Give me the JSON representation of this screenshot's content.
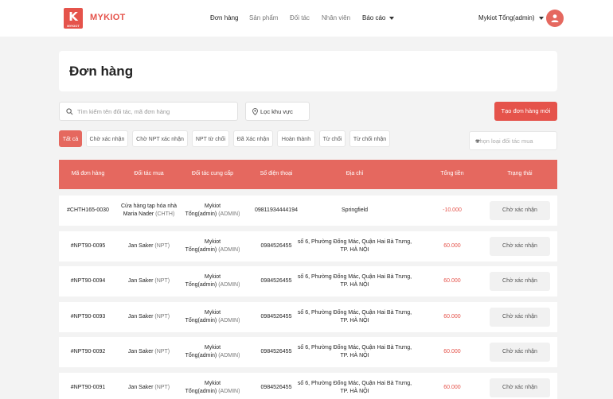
{
  "brand": {
    "logo_letter": "K",
    "logo_small": "MYKIOT",
    "name": "MYKIOT",
    "color": "#e5534b"
  },
  "nav": [
    {
      "label": "Đơn hàng",
      "active": true
    },
    {
      "label": "Sản phẩm",
      "active": false
    },
    {
      "label": "Đối tác",
      "active": false
    },
    {
      "label": "Nhân viên",
      "active": false
    },
    {
      "label": "Báo cáo",
      "active": false,
      "dropdown": true
    }
  ],
  "user": {
    "name": "Mykiot Tổng(admin)",
    "avatar_icon": "user-icon"
  },
  "page": {
    "title": "Đơn hàng"
  },
  "filters": {
    "search_placeholder": "Tìm kiếm tên đối tác, mã đơn hàng",
    "region_label": "Lọc khu vực",
    "create_button": "Tạo đơn hàng mới",
    "partner_type_placeholder": "Chọn loại đối tác mua"
  },
  "tabs": [
    {
      "label": "Tất cả",
      "active": true
    },
    {
      "label": "Chờ xác nhận",
      "active": false
    },
    {
      "label": "Chờ NPT xác nhận",
      "active": false
    },
    {
      "label": "NPT từ chối",
      "active": false
    },
    {
      "label": "Đã Xác nhận",
      "active": false
    },
    {
      "label": "Hoàn thành",
      "active": false
    },
    {
      "label": "Từ chối",
      "active": false
    },
    {
      "label": "Từ chối nhận",
      "active": false
    }
  ],
  "table": {
    "header_color": "#e5685f",
    "columns": [
      "Mã đơn hàng",
      "Đối tác mua",
      "Đối tác cung cấp",
      "Số điện thoại",
      "Địa chỉ",
      "Tổng tiền",
      "Trạng thái"
    ],
    "rows": [
      {
        "code": "#CHTH165-0030",
        "buyer_line1": "Cửa hàng tạp hóa nhà",
        "buyer_line2": "Maria Nader",
        "buyer_tag": "(CHTH)",
        "supplier_line1": "Mykiot",
        "supplier_line2": "Tổng(admin)",
        "supplier_tag": "(ADMIN)",
        "phone": "09811934444194",
        "address_line1": "Springfield",
        "address_line2": "",
        "total": "-10.000",
        "status": "Chờ xác nhận"
      },
      {
        "code": "#NPT90-0095",
        "buyer_line1": "Jan Saker",
        "buyer_line2": "",
        "buyer_tag": "(NPT)",
        "supplier_line1": "Mykiot",
        "supplier_line2": "Tổng(admin)",
        "supplier_tag": "(ADMIN)",
        "phone": "0984526455",
        "address_line1": "số 6, Phường Đống Mác, Quận Hai Bà Trưng,",
        "address_line2": "TP. HÀ NỘI",
        "total": "60.000",
        "status": "Chờ xác nhận"
      },
      {
        "code": "#NPT90-0094",
        "buyer_line1": "Jan Saker",
        "buyer_line2": "",
        "buyer_tag": "(NPT)",
        "supplier_line1": "Mykiot",
        "supplier_line2": "Tổng(admin)",
        "supplier_tag": "(ADMIN)",
        "phone": "0984526455",
        "address_line1": "số 6, Phường Đống Mác, Quận Hai Bà Trưng,",
        "address_line2": "TP. HÀ NỘI",
        "total": "60.000",
        "status": "Chờ xác nhận"
      },
      {
        "code": "#NPT90-0093",
        "buyer_line1": "Jan Saker",
        "buyer_line2": "",
        "buyer_tag": "(NPT)",
        "supplier_line1": "Mykiot",
        "supplier_line2": "Tổng(admin)",
        "supplier_tag": "(ADMIN)",
        "phone": "0984526455",
        "address_line1": "số 6, Phường Đống Mác, Quận Hai Bà Trưng,",
        "address_line2": "TP. HÀ NỘI",
        "total": "60.000",
        "status": "Chờ xác nhận"
      },
      {
        "code": "#NPT90-0092",
        "buyer_line1": "Jan Saker",
        "buyer_line2": "",
        "buyer_tag": "(NPT)",
        "supplier_line1": "Mykiot",
        "supplier_line2": "Tổng(admin)",
        "supplier_tag": "(ADMIN)",
        "phone": "0984526455",
        "address_line1": "số 6, Phường Đống Mác, Quận Hai Bà Trưng,",
        "address_line2": "TP. HÀ NỘI",
        "total": "60.000",
        "status": "Chờ xác nhận"
      },
      {
        "code": "#NPT90-0091",
        "buyer_line1": "Jan Saker",
        "buyer_line2": "",
        "buyer_tag": "(NPT)",
        "supplier_line1": "Mykiot",
        "supplier_line2": "Tổng(admin)",
        "supplier_tag": "(ADMIN)",
        "phone": "0984526455",
        "address_line1": "số 6, Phường Đống Mác, Quận Hai Bà Trưng,",
        "address_line2": "TP. HÀ NỘI",
        "total": "60.000",
        "status": "Chờ xác nhận"
      }
    ]
  }
}
